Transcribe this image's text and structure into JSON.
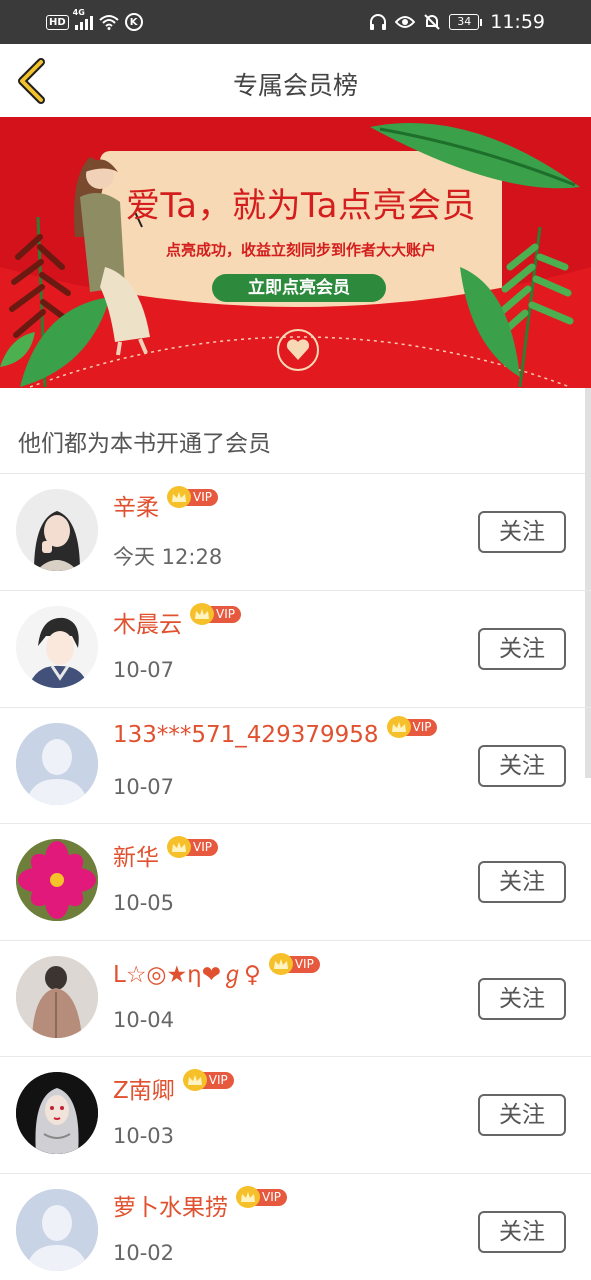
{
  "status_bar": {
    "hd": "HD",
    "network": "4G",
    "k_icon": "K",
    "battery": "34",
    "time": "11:59"
  },
  "header": {
    "title": "专属会员榜",
    "back_icon": "chevron-left-icon"
  },
  "banner": {
    "headline": "爱Ta，就为Ta点亮会员",
    "subtitle": "点亮成功，收益立刻同步到作者大大账户",
    "cta_label": "立即点亮会员"
  },
  "section": {
    "title": "他们都为本书开通了会员"
  },
  "vip_label": "VIP",
  "follow_label": "关注",
  "members": [
    {
      "name": "辛柔",
      "date": "今天 12:28",
      "avatar": "girl-photo"
    },
    {
      "name": "木晨云",
      "date": "10-07",
      "avatar": "anime-boy"
    },
    {
      "name": "133***571_429379958",
      "date": "10-07",
      "avatar": "default-silhouette"
    },
    {
      "name": "新华",
      "date": "10-05",
      "avatar": "pink-flower"
    },
    {
      "name": "L☆◎★η❤ℊ♀",
      "date": "10-04",
      "avatar": "back-photo"
    },
    {
      "name": "Z南卿",
      "date": "10-03",
      "avatar": "anime-girl"
    },
    {
      "name": "萝卜水果捞",
      "date": "10-02",
      "avatar": "default-silhouette"
    }
  ],
  "colors": {
    "accent": "#e0512f",
    "banner_red": "#d3121c",
    "vip_gold": "#f5c02a",
    "vip_tag": "#e7593e"
  }
}
